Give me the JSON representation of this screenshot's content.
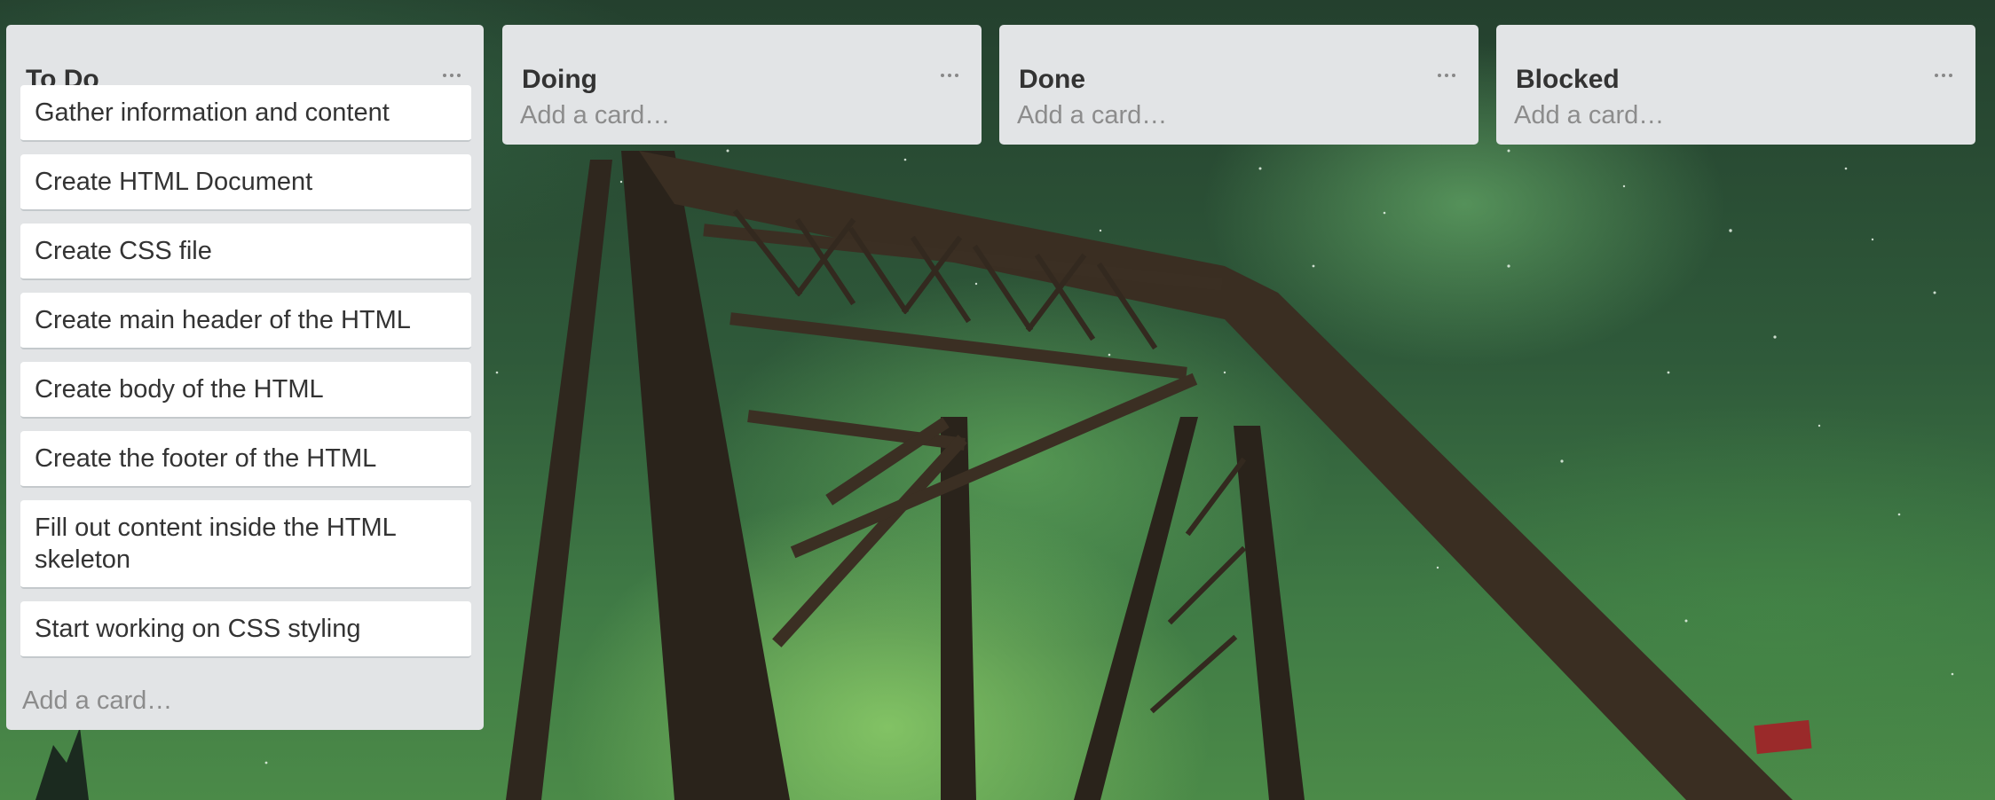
{
  "lists": [
    {
      "title": "To Do",
      "menu_icon": "ellipsis-icon",
      "cards": [
        "Gather information and content",
        "Create HTML Document",
        "Create CSS file",
        "Create main header of the HTML",
        "Create body of the HTML",
        "Create the footer of the HTML",
        "Fill out content inside the HTML skeleton",
        "Start working on CSS styling"
      ],
      "add_card": "Add a card…"
    },
    {
      "title": "Doing",
      "menu_icon": "ellipsis-icon",
      "cards": [],
      "add_card": "Add a card…"
    },
    {
      "title": "Done",
      "menu_icon": "ellipsis-icon",
      "cards": [],
      "add_card": "Add a card…"
    },
    {
      "title": "Blocked",
      "menu_icon": "ellipsis-icon",
      "cards": [],
      "add_card": "Add a card…"
    }
  ],
  "colors": {
    "list_bg": "#e2e4e6",
    "card_bg": "#ffffff",
    "title_text": "#333333",
    "placeholder_text": "#8c8c8c"
  }
}
